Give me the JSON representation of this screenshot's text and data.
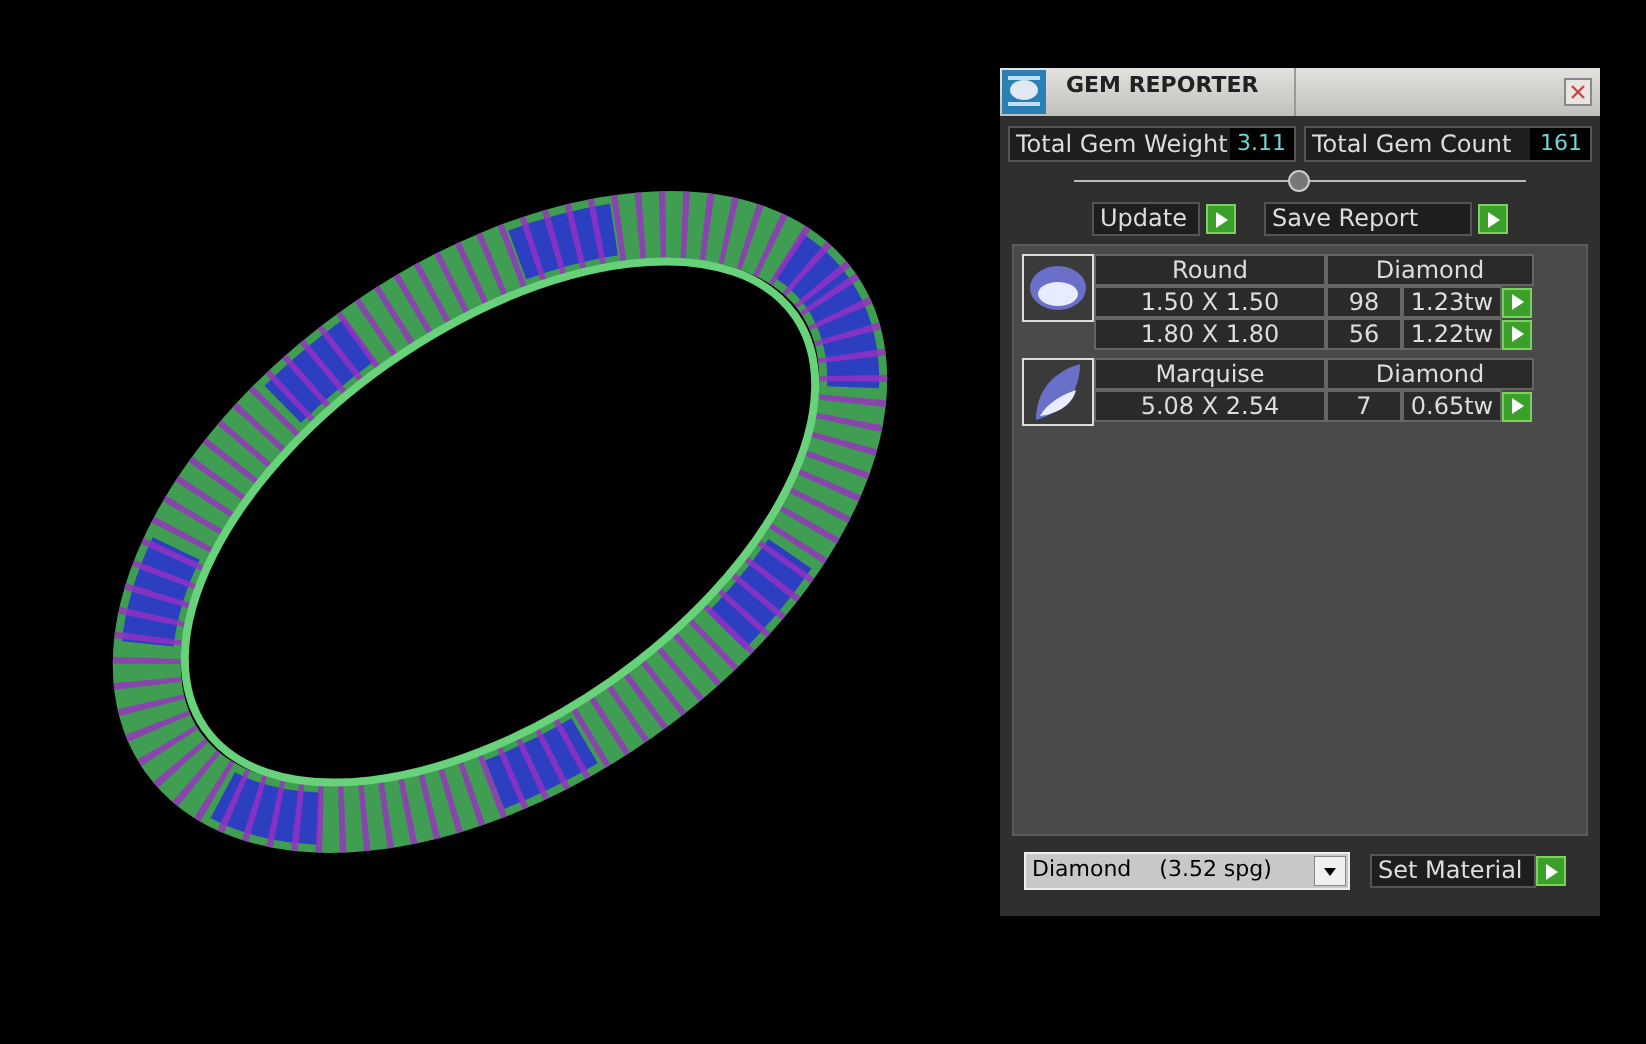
{
  "window": {
    "title": "GEM REPORTER"
  },
  "totals": [
    {
      "label": "Total Gem Weight",
      "value": "3.11"
    },
    {
      "label": "Total Gem Count",
      "value": "161"
    }
  ],
  "actions": [
    {
      "label": "Update"
    },
    {
      "label": "Save Report"
    }
  ],
  "gem_groups": [
    {
      "kind": "round",
      "shape": "Round",
      "material": "Diamond",
      "rows": [
        {
          "size": "1.50 X 1.50",
          "count": "98",
          "weight": "1.23tw"
        },
        {
          "size": "1.80 X 1.80",
          "count": "56",
          "weight": "1.22tw"
        }
      ]
    },
    {
      "kind": "marquise",
      "shape": "Marquise",
      "material": "Diamond",
      "rows": [
        {
          "size": "5.08 X 2.54",
          "count": "7",
          "weight": "0.65tw"
        }
      ]
    }
  ],
  "material_select": {
    "value": "Diamond    (3.52 spg)"
  },
  "set_button": {
    "label": "Set Material"
  }
}
